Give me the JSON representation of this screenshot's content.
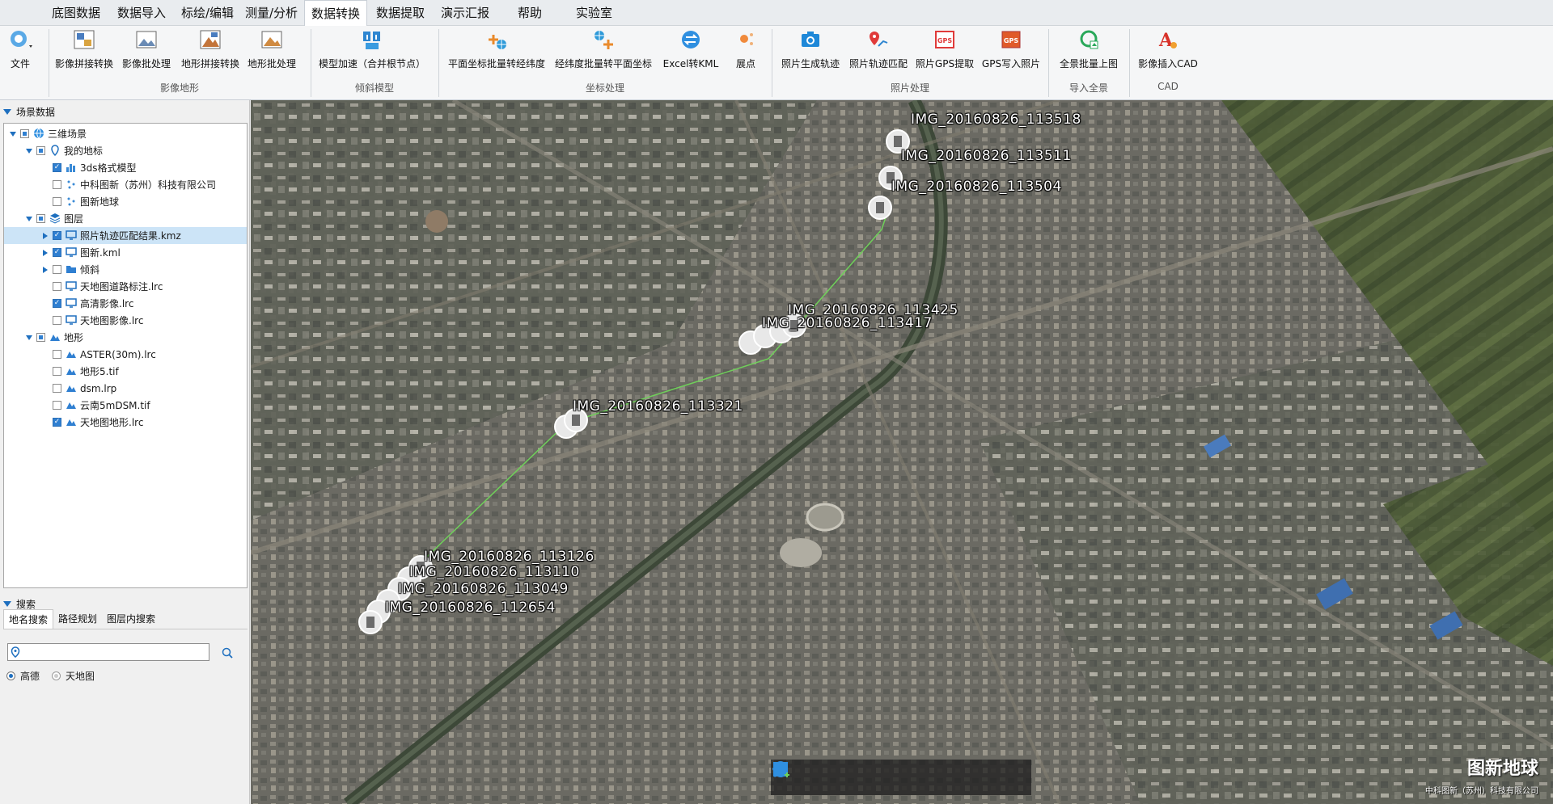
{
  "menu": {
    "items": [
      "底图数据",
      "数据导入",
      "标绘/编辑",
      "测量/分析",
      "数据转换",
      "数据提取",
      "演示汇报",
      "帮助",
      "实验室"
    ],
    "active": "数据转换"
  },
  "ribbon": {
    "file_label": "文件",
    "buttons": [
      {
        "label": "影像拼接转换",
        "icon": "image-mosaic-icon"
      },
      {
        "label": "影像批处理",
        "icon": "image-batch-icon"
      },
      {
        "label": "地形拼接转换",
        "icon": "terrain-mosaic-icon"
      },
      {
        "label": "地形批处理",
        "icon": "terrain-batch-icon"
      },
      {
        "label": "模型加速（合并根节点）",
        "icon": "model-accelerate-icon"
      },
      {
        "label": "平面坐标批量转经纬度",
        "icon": "plane-to-latlon-icon"
      },
      {
        "label": "经纬度批量转平面坐标",
        "icon": "latlon-to-plane-icon"
      },
      {
        "label": "Excel转KML",
        "icon": "excel-to-kml-icon"
      },
      {
        "label": "展点",
        "icon": "scatter-points-icon"
      },
      {
        "label": "照片生成轨迹",
        "icon": "photo-track-icon"
      },
      {
        "label": "照片轨迹匹配",
        "icon": "photo-match-icon"
      },
      {
        "label": "照片GPS提取",
        "icon": "gps-extract-icon"
      },
      {
        "label": "GPS写入照片",
        "icon": "gps-write-icon"
      },
      {
        "label": "全景批量上图",
        "icon": "panorama-batch-icon"
      },
      {
        "label": "影像插入CAD",
        "icon": "cad-insert-icon"
      }
    ],
    "groups": [
      "影像地形",
      "倾斜模型",
      "坐标处理",
      "照片处理",
      "导入全景",
      "CAD"
    ]
  },
  "left_panel": {
    "scene_title": "场景数据",
    "tree": [
      {
        "label": "三维场景",
        "level": 0,
        "expanded": true,
        "check": "partial",
        "icon": "globe-icon"
      },
      {
        "label": "我的地标",
        "level": 1,
        "expanded": true,
        "check": "partial",
        "icon": "pin-icon"
      },
      {
        "label": "3ds格式模型",
        "level": 2,
        "check": "checked",
        "icon": "chart-model-icon"
      },
      {
        "label": "中科图新（苏州）科技有限公司",
        "level": 2,
        "check": "none",
        "icon": "point-icon"
      },
      {
        "label": "图新地球",
        "level": 2,
        "check": "none",
        "icon": "point-icon"
      },
      {
        "label": "图层",
        "level": 1,
        "expanded": true,
        "check": "partial",
        "icon": "layers-icon"
      },
      {
        "label": "照片轨迹匹配结果.kmz",
        "level": 2,
        "check": "checked",
        "icon": "monitor-icon",
        "collapsed": true,
        "selected": true
      },
      {
        "label": "图新.kml",
        "level": 2,
        "check": "checked",
        "icon": "monitor-icon",
        "collapsed": true
      },
      {
        "label": "倾斜",
        "level": 2,
        "check": "none",
        "icon": "folder-icon",
        "collapsed": true
      },
      {
        "label": "天地图道路标注.lrc",
        "level": 2,
        "check": "none",
        "icon": "monitor-icon"
      },
      {
        "label": "高清影像.lrc",
        "level": 2,
        "check": "checked",
        "icon": "monitor-icon"
      },
      {
        "label": "天地图影像.lrc",
        "level": 2,
        "check": "none",
        "icon": "monitor-icon"
      },
      {
        "label": "地形",
        "level": 1,
        "expanded": true,
        "check": "partial",
        "icon": "terrain-icon"
      },
      {
        "label": "ASTER(30m).lrc",
        "level": 2,
        "check": "none",
        "icon": "terrain-icon"
      },
      {
        "label": "地形5.tif",
        "level": 2,
        "check": "none",
        "icon": "terrain-icon"
      },
      {
        "label": "dsm.lrp",
        "level": 2,
        "check": "none",
        "icon": "terrain-icon"
      },
      {
        "label": "云南5mDSM.tif",
        "level": 2,
        "check": "none",
        "icon": "terrain-icon"
      },
      {
        "label": "天地图地形.lrc",
        "level": 2,
        "check": "checked",
        "icon": "terrain-icon"
      }
    ],
    "search_title": "搜索",
    "search_tabs": [
      "地名搜索",
      "路径规划",
      "图层内搜索"
    ],
    "search_value": "",
    "radios": [
      {
        "label": "高德",
        "selected": true
      },
      {
        "label": "天地图",
        "selected": false
      }
    ]
  },
  "map": {
    "photo_labels": [
      "IMG_20160826_113518",
      "IMG_20160826_113511",
      "IMG_20160826_113504",
      "IMG_20160826_113425",
      "IMG_20160826_113417",
      "IMG_20160826_113321",
      "IMG_20160826_113126",
      "IMG_20160826_113110",
      "IMG_20160826_113049",
      "IMG_20160826_112654"
    ],
    "tools": [
      "pan-hand-icon",
      "select-arrow-icon",
      "placemark-icon",
      "polyline-icon",
      "polygon-icon",
      "chart-add-icon"
    ],
    "brand": "图新地球",
    "brand_sub": "中科图新（苏州）科技有限公司",
    "track_color": "#6fd05a"
  }
}
